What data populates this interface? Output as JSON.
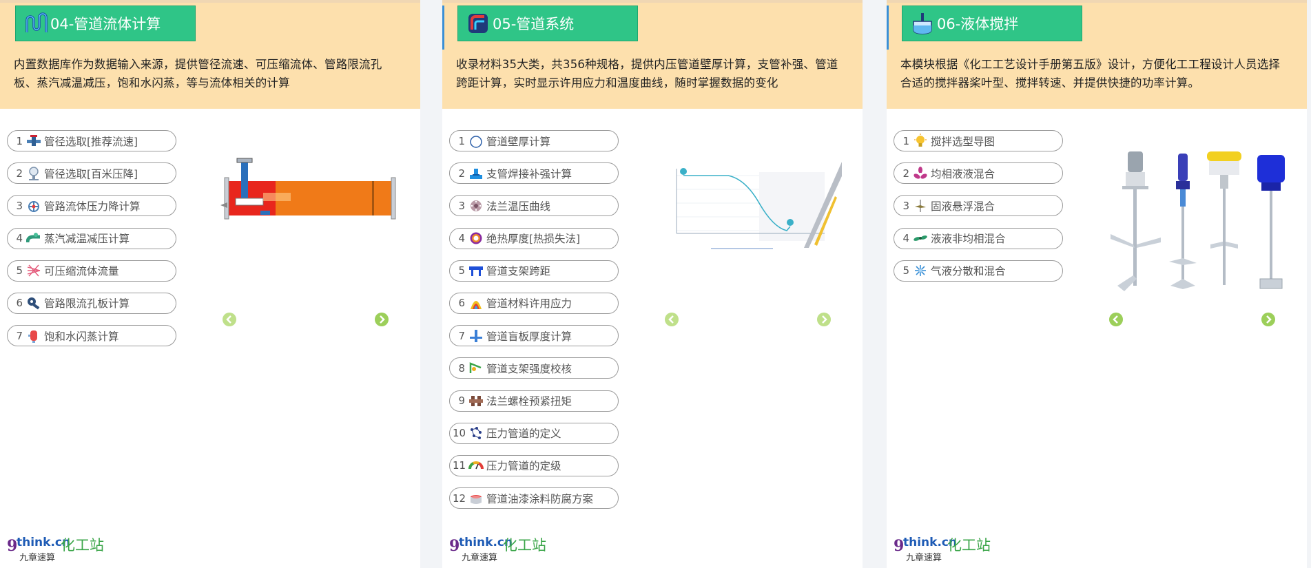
{
  "panels": [
    {
      "title": "04-管道流体计算",
      "description": "内置数据库作为数据输入来源，提供管径流速、可压缩流体、管路限流孔板、蒸汽减温减压，饱和水闪蒸，等与流体相关的计算",
      "items": [
        {
          "num": "1",
          "label": "管径选取[推荐流速]",
          "icon": "pipe-valve-icon"
        },
        {
          "num": "2",
          "label": "管径选取[百米压降]",
          "icon": "pressure-gauge-icon"
        },
        {
          "num": "3",
          "label": "管路流体压力降计算",
          "icon": "valve-wheel-icon"
        },
        {
          "num": "4",
          "label": "蒸汽减温减压计算",
          "icon": "steam-pipe-icon"
        },
        {
          "num": "5",
          "label": "可压缩流体流量",
          "icon": "compressible-flow-icon"
        },
        {
          "num": "6",
          "label": "管路限流孔板计算",
          "icon": "orifice-plate-icon"
        },
        {
          "num": "7",
          "label": "饱和水闪蒸计算",
          "icon": "flash-tank-icon"
        }
      ]
    },
    {
      "title": "05-管道系统",
      "description": "收录材料35大类，共356种规格，提供内压管道壁厚计算，支管补强、管道跨距计算，实时显示许用应力和温度曲线，随时掌握数据的变化",
      "items": [
        {
          "num": "1",
          "label": "管道壁厚计算",
          "icon": "circle-icon"
        },
        {
          "num": "2",
          "label": "支管焊接补强计算",
          "icon": "branch-weld-icon"
        },
        {
          "num": "3",
          "label": "法兰温压曲线",
          "icon": "flange-icon"
        },
        {
          "num": "4",
          "label": "绝热厚度[热损失法]",
          "icon": "insulation-ring-icon"
        },
        {
          "num": "5",
          "label": "管道支架跨距",
          "icon": "pipe-support-icon"
        },
        {
          "num": "6",
          "label": "管道材料许用应力",
          "icon": "stress-spectrum-icon"
        },
        {
          "num": "7",
          "label": "管道盲板厚度计算",
          "icon": "blind-plate-icon"
        },
        {
          "num": "8",
          "label": "管道支架强度校核",
          "icon": "support-check-icon"
        },
        {
          "num": "9",
          "label": "法兰螺栓预紧扭矩",
          "icon": "bolt-torque-icon"
        },
        {
          "num": "10",
          "label": "压力管道的定义",
          "icon": "pressure-definition-icon"
        },
        {
          "num": "11",
          "label": "压力管道的定级",
          "icon": "gauge-meter-icon"
        },
        {
          "num": "12",
          "label": "管道油漆涂料防腐方案",
          "icon": "paint-bucket-icon"
        }
      ]
    },
    {
      "title": "06-液体搅拌",
      "description": "本模块根据《化工工艺设计手册第五版》设计，方便化工工程设计人员选择合适的搅拌器桨叶型、搅拌转速、并提供快捷的功率计算。",
      "items": [
        {
          "num": "1",
          "label": "搅拌选型导图",
          "icon": "lightbulb-icon"
        },
        {
          "num": "2",
          "label": "均相液液混合",
          "icon": "propeller-icon"
        },
        {
          "num": "3",
          "label": "固液悬浮混合",
          "icon": "blade-icon"
        },
        {
          "num": "4",
          "label": "液液非均相混合",
          "icon": "mixer-icon"
        },
        {
          "num": "5",
          "label": "气液分散和混合",
          "icon": "disperser-icon"
        }
      ]
    }
  ],
  "logo": {
    "mark": "9",
    "domain": "think.cn",
    "brand": "化工站",
    "tagline": "九章速算"
  },
  "colors": {
    "header_bg": "#fde0ad",
    "tab_green": "#2fc587",
    "arrow_green": "#9ccf5a"
  }
}
